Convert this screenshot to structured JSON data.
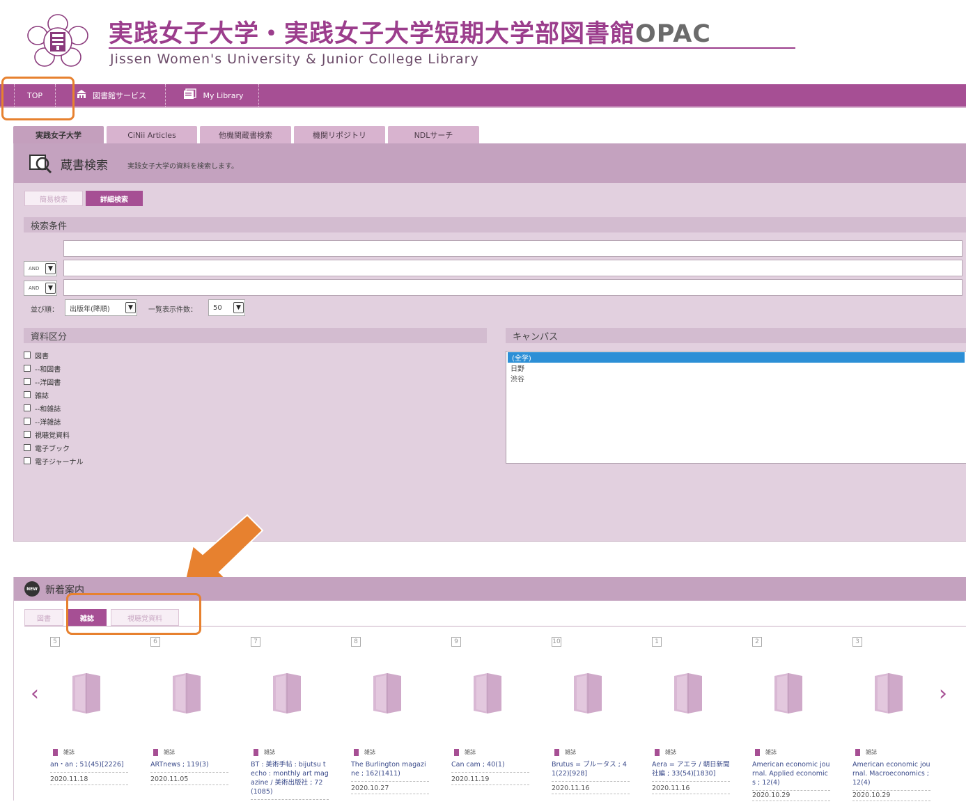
{
  "header": {
    "title_jp": "実践女子大学・実践女子大学短期大学部図書館",
    "title_opac": "OPAC",
    "title_en": "Jissen Women's University & Junior College Library"
  },
  "nav": {
    "top": "TOP",
    "service": "図書館サービス",
    "mylibrary": "My Library"
  },
  "tabs": [
    "実践女子大学",
    "CiNii Articles",
    "他機関蔵書検索",
    "機関リポジトリ",
    "NDLサーチ"
  ],
  "search_panel": {
    "title": "蔵書検索",
    "description": "実践女子大学の資料を検索します。",
    "mode_simple": "簡易検索",
    "mode_detail": "詳細検索",
    "conditions_label": "検索条件",
    "operator_1": "AND",
    "operator_2": "AND",
    "sort_label": "並び順：",
    "sort_value": "出版年(降順)",
    "per_page_label": "一覧表示件数：",
    "per_page_value": "50"
  },
  "material_type": {
    "label": "資料区分",
    "options": [
      "図書",
      "--和図書",
      "--洋図書",
      "雑誌",
      "--和雑誌",
      "--洋雑誌",
      "視聴覚資料",
      "電子ブック",
      "電子ジャーナル"
    ]
  },
  "campus": {
    "label": "キャンパス",
    "options": [
      "(全学)",
      "日野",
      "渋谷"
    ],
    "selected": "(全学)"
  },
  "new_arrivals": {
    "title": "新着案内",
    "badge": "NEW",
    "tabs": [
      "図書",
      "雑誌",
      "視聴覚資料"
    ],
    "prev_icon": "‹",
    "next_icon": "›",
    "items": [
      {
        "num": "5",
        "type": "雑誌",
        "title": "an・an ; 51(45)[2226]",
        "date": "2020.11.18"
      },
      {
        "num": "6",
        "type": "雑誌",
        "title": "ARTnews ; 119(3)",
        "date": "2020.11.05"
      },
      {
        "num": "7",
        "type": "雑誌",
        "title": "BT : 美術手帖 : bijutsu techo : monthly art magazine / 美術出版社 ; 72(1085)",
        "date": ""
      },
      {
        "num": "8",
        "type": "雑誌",
        "title": "The Burlington magazine ; 162(1411)",
        "date": "2020.10.27"
      },
      {
        "num": "9",
        "type": "雑誌",
        "title": "Can cam ; 40(1)",
        "date": "2020.11.19"
      },
      {
        "num": "10",
        "type": "雑誌",
        "title": "Brutus = ブルータス ; 41(22)[928]",
        "date": "2020.11.16"
      },
      {
        "num": "1",
        "type": "雑誌",
        "title": "Aera = アエラ / 朝日新聞社編 ; 33(54)[1830]",
        "date": "2020.11.16"
      },
      {
        "num": "2",
        "type": "雑誌",
        "title": "American economic journal. Applied economics ; 12(4)",
        "date": "2020.10.29"
      },
      {
        "num": "3",
        "type": "雑誌",
        "title": "American economic journal. Macroeconomics ; 12(4)",
        "date": "2020.10.29"
      }
    ]
  }
}
